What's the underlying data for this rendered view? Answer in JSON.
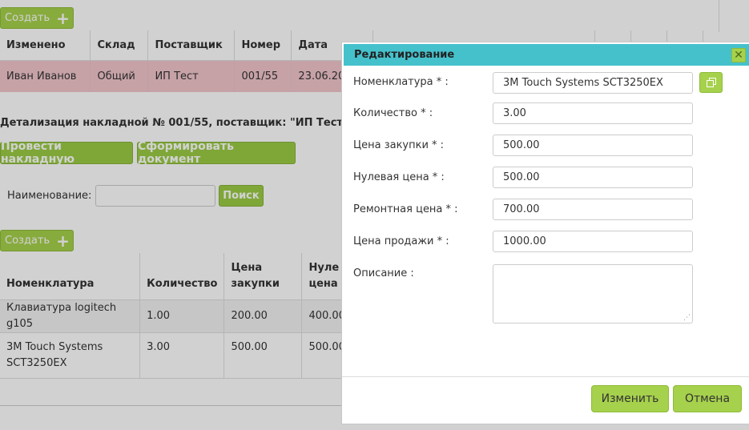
{
  "toolbar": {
    "create_label": "Создать",
    "create_icon": "plus-icon"
  },
  "invoices_table": {
    "headers": [
      "Изменено",
      "Склад",
      "Поставщик",
      "Номер",
      "Дата",
      "",
      "",
      "",
      ""
    ],
    "rows": [
      [
        "Иван Иванов",
        "Общий",
        "ИП Тест",
        "001/55",
        "23.06.20"
      ]
    ]
  },
  "detail": {
    "title": "Детализация накладной № 001/55, поставщик: \"ИП Тест\"",
    "post_button": "Провести накладную",
    "form_button": "Сформировать документ",
    "search_label": "Наименование:",
    "search_button": "Поиск",
    "create_label": "Создать"
  },
  "items_table": {
    "headers": [
      [
        "Номенклатура"
      ],
      [
        "Количество"
      ],
      [
        "Цена",
        "закупки"
      ],
      [
        "Нуле",
        "цена"
      ]
    ],
    "rows": [
      [
        "Клавиатура logitech g105",
        "1.00",
        "200.00",
        "400.00"
      ],
      [
        "3M Touch Systems",
        "SCT3250EX",
        "3.00",
        "500.00",
        "500.00"
      ]
    ]
  },
  "dialog": {
    "title": "Редактирование",
    "close_icon": "close-icon",
    "fields": {
      "nomenclature": {
        "label": "Номенклатура * :",
        "value": "3M Touch Systems SCT3250EX"
      },
      "quantity": {
        "label": "Количество * :",
        "value": "3.00"
      },
      "purchase_price": {
        "label": "Цена закупки * :",
        "value": "500.00"
      },
      "zero_price": {
        "label": "Нулевая цена * :",
        "value": "500.00"
      },
      "repair_price": {
        "label": "Ремонтная цена * :",
        "value": "700.00"
      },
      "sale_price": {
        "label": "Цена продажи * :",
        "value": "1000.00"
      },
      "description": {
        "label": "Описание :",
        "value": ""
      }
    },
    "pick_icon": "open-window-icon",
    "save_button": "Изменить",
    "cancel_button": "Отмена"
  },
  "colors": {
    "accent_green": "#a6d14c",
    "header_teal": "#45c1cc",
    "selected_row": "#f2c6cc"
  }
}
